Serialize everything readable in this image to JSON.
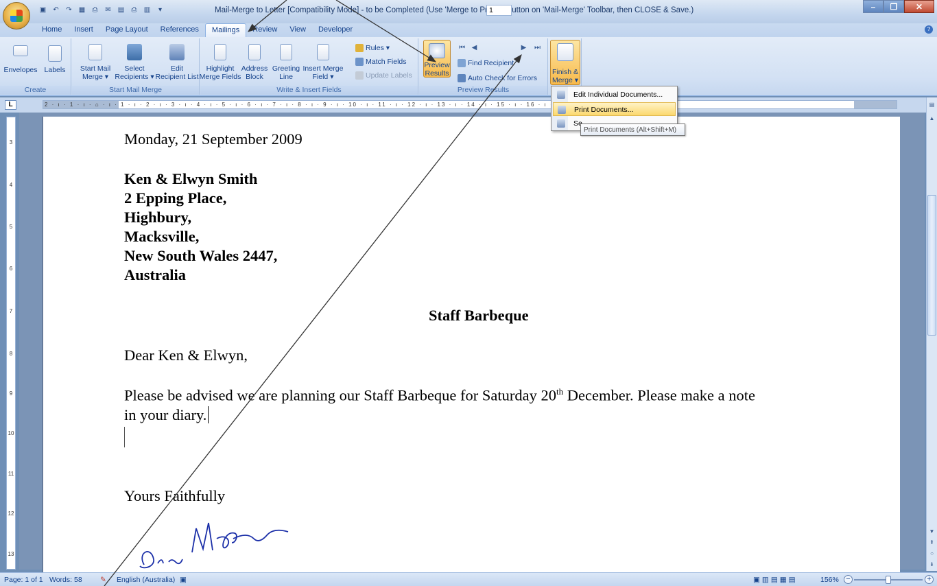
{
  "titlebar": {
    "title": "Mail-Merge to Letter [Compatibility Mode] - to be Completed (Use 'Merge to Printer' Button on 'Mail-Merge' Toolbar, then CLOSE & Save.)",
    "minimize": "–",
    "restore": "❐",
    "close": "✕"
  },
  "tabs": [
    "Home",
    "Insert",
    "Page Layout",
    "References",
    "Mailings",
    "Review",
    "View",
    "Developer"
  ],
  "active_tab": "Mailings",
  "ribbon": {
    "create": {
      "title": "Create",
      "envelopes": "Envelopes",
      "labels": "Labels"
    },
    "start": {
      "title": "Start Mail Merge",
      "start_l1": "Start Mail",
      "start_l2": "Merge ▾",
      "select_l1": "Select",
      "select_l2": "Recipients ▾",
      "edit_l1": "Edit",
      "edit_l2": "Recipient List"
    },
    "write": {
      "title": "Write & Insert Fields",
      "highlight_l1": "Highlight",
      "highlight_l2": "Merge Fields",
      "address_l1": "Address",
      "address_l2": "Block",
      "greeting_l1": "Greeting",
      "greeting_l2": "Line",
      "insert_l1": "Insert Merge",
      "insert_l2": "Field ▾",
      "rules": "Rules ▾",
      "match": "Match Fields",
      "update": "Update Labels"
    },
    "preview": {
      "title": "Preview Results",
      "preview_l1": "Preview",
      "preview_l2": "Results",
      "record": "1",
      "find": "Find Recipient",
      "auto": "Auto Check for Errors"
    },
    "finish": {
      "finish_l1": "Finish &",
      "finish_l2": "Merge ▾"
    }
  },
  "ruler": {
    "marks": "2 · ı · 1 · ı · ⌂ · ı · 1 · ı · 2 · ı · 3 · ı · 4 · ı · 5 · ı · 6 · ı · 7 · ı · 8 · ı · 9 · ı · 10 · ı · 11 · ı · 12 · ı · 13 · ı · 14 · ı · 15 · ı · 16 · ı · 17 · △ · 18 · ı ·",
    "btn": "L",
    "vmarks": [
      "3",
      "4",
      "5",
      "6",
      "7",
      "8",
      "9",
      "10",
      "11",
      "12",
      "13"
    ]
  },
  "document": {
    "date": "Monday, 21 September 2009",
    "name": "Ken & Elwyn  Smith",
    "addr1": "2 Epping Place,",
    "addr2": "Highbury,",
    "addr3": "Macksville,",
    "addr4": "New South  Wales 2447,",
    "addr5": "Australia",
    "heading": "Staff Barbeque",
    "salutation": "Dear Ken & Elwyn,",
    "body1_pre": "Please be advised we are planning our Staff Barbeque for Saturday 20",
    "body1_sup": "th",
    "body1_post": " December.  Please make a note",
    "body2": "in your diary.",
    "closing": "Yours Faithfully",
    "signature": "Brian McGuigan"
  },
  "finish_menu": {
    "edit": "Edit Individual Documents...",
    "print": "Print Documents...",
    "send": "Se"
  },
  "tooltip": "Print Documents (Alt+Shift+M)",
  "status": {
    "page": "Page: 1 of 1",
    "words": "Words: 58",
    "language": "English (Australia)",
    "zoom": "156%"
  }
}
